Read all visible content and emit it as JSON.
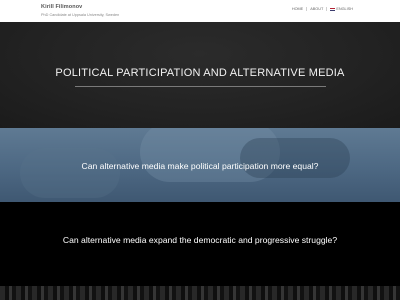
{
  "header": {
    "name": "Kirill Filimonov",
    "subtitle": "PhD Candidate at Uppsala University, Sweden",
    "nav": [
      {
        "label": "Home"
      },
      {
        "label": "About"
      },
      {
        "label": "English",
        "icon": "flag-icon"
      }
    ]
  },
  "hero": {
    "title": "POLITICAL PARTICIPATION AND ALTERNATIVE MEDIA"
  },
  "questions": [
    "Can alternative media make political participation more equal?",
    "Can alternative media expand the democratic and progressive struggle?"
  ],
  "colors": {
    "hero_bg": "#232323",
    "band_bg": "#4d6883",
    "dark_bg": "#000000"
  }
}
